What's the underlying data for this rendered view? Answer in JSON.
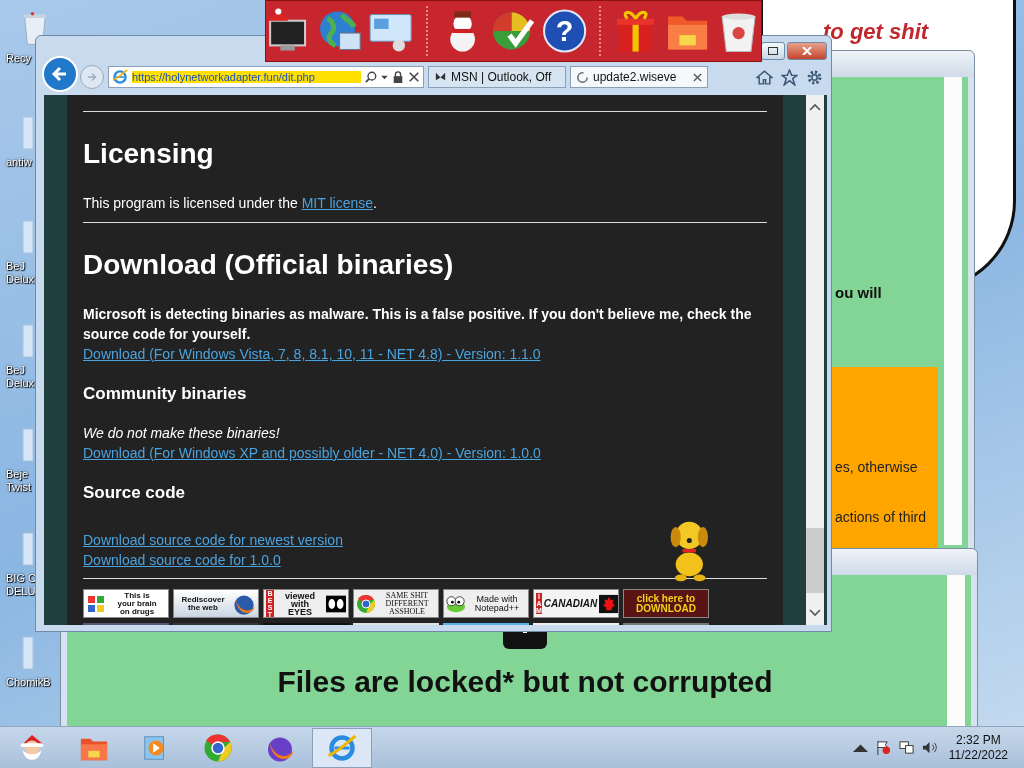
{
  "desktop": {
    "icons": [
      {
        "label": "Recy",
        "kind": "bin"
      },
      {
        "label": "antiw",
        "kind": "file"
      },
      {
        "label": "BeJ\nDelux",
        "kind": "file"
      },
      {
        "label": "BeJ\nDelux",
        "kind": "file"
      },
      {
        "label": "Beje\nTwist",
        "kind": "file"
      },
      {
        "label": "BIG C\nDELU",
        "kind": "file"
      },
      {
        "label": "ChomikB",
        "kind": "file"
      }
    ]
  },
  "gadget_bar": {
    "help_symbol": "?"
  },
  "speech_bubble": {
    "text": "to get shit"
  },
  "background_window": {
    "bold_text": "ou will",
    "orange_box_lines": [
      "es, otherwise",
      "actions of third"
    ]
  },
  "lower_window": {
    "message": "Files are locked* but not corrupted"
  },
  "browser": {
    "address": "https://holynetworkadapter.fun/dit.php",
    "tabs": [
      {
        "title": "MSN | Outlook, Off",
        "kind": "msn",
        "selected": false
      },
      {
        "title": "update2.wiseve",
        "kind": "loading",
        "selected": true
      }
    ],
    "page": {
      "licensing": {
        "heading": "Licensing",
        "text_before": "This program is licensed under the ",
        "link": "MIT license",
        "text_after": "."
      },
      "download": {
        "heading": "Download (Official binaries)",
        "warning": "Microsoft is detecting binaries as malware. This is a false positive. If you don't believe me, check the source code for yourself.",
        "link": "Download (For Windows Vista, 7, 8, 8.1, 10, 11 - NET 4.8) - Version: 1.1.0"
      },
      "community": {
        "heading": "Community binaries",
        "note": "We do not make these binaries!",
        "link": "Download (For Windows XP and possibly older - NET 4.0) - Version: 1.0.0"
      },
      "source": {
        "heading": "Source code",
        "links": [
          "Download source code for newest version",
          "Download source code for 1.0.0"
        ]
      },
      "badges": [
        {
          "kind": "brain",
          "text": "This is\nyour brain\non drugs"
        },
        {
          "kind": "firefox",
          "text": "Rediscover\nthe web"
        },
        {
          "kind": "eyes",
          "side": "BEST",
          "text": "viewed with\nEYES"
        },
        {
          "kind": "chrome",
          "text": "SAME SHIT\nDIFFERENT\nASSHOLE"
        },
        {
          "kind": "notepad",
          "text": "Made with\nNotepad++"
        },
        {
          "kind": "canadian",
          "side": "I AM",
          "text": "CANADIAN"
        },
        {
          "kind": "download",
          "text": "click here to\nDOWNLOAD"
        }
      ]
    }
  },
  "taskbar": {
    "apps": [
      {
        "kind": "santa",
        "selected": false
      },
      {
        "kind": "folder",
        "selected": false
      },
      {
        "kind": "media",
        "selected": false
      },
      {
        "kind": "chrome",
        "selected": false
      },
      {
        "kind": "firefox",
        "selected": false
      },
      {
        "kind": "ie",
        "selected": true
      }
    ],
    "clock": {
      "time": "2:32 PM",
      "date": "11/22/2022"
    }
  }
}
